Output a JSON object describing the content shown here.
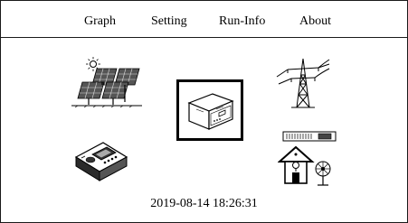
{
  "menu": {
    "items": [
      {
        "label": "Graph"
      },
      {
        "label": "Setting"
      },
      {
        "label": "Run-Info"
      },
      {
        "label": "About"
      }
    ]
  },
  "diagram": {
    "icons": [
      "solar-panel-icon",
      "inverter-icon",
      "power-grid-icon",
      "energy-meter-icon",
      "house-load-icon"
    ]
  },
  "status": {
    "datetime": "2019-08-14 18:26:31"
  },
  "colors": {
    "foreground": "#000000",
    "background": "#ffffff"
  }
}
